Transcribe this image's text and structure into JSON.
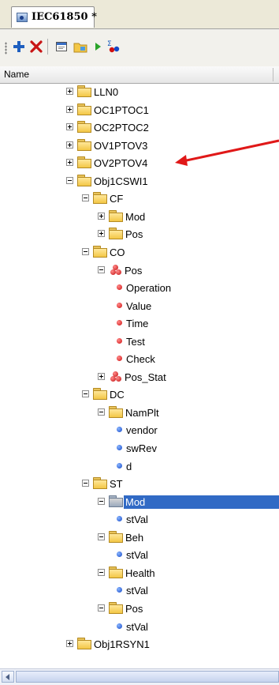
{
  "tab": {
    "title": "IEC61850 *"
  },
  "toolbar": {
    "buttons": [
      {
        "icon": "add-icon"
      },
      {
        "icon": "delete-icon"
      },
      {
        "icon": "window-icon"
      },
      {
        "icon": "folder-icon"
      },
      {
        "icon": "play-icon"
      },
      {
        "icon": "sum-icon"
      }
    ]
  },
  "header": {
    "name": "Name"
  },
  "tree": {
    "nodes": [
      {
        "label": "LLN0",
        "indent": 0,
        "expander": "plus",
        "icon": "folder"
      },
      {
        "label": "OC1PTOC1",
        "indent": 0,
        "expander": "plus",
        "icon": "folder"
      },
      {
        "label": "OC2PTOC2",
        "indent": 0,
        "expander": "plus",
        "icon": "folder"
      },
      {
        "label": "OV1PTOV3",
        "indent": 0,
        "expander": "plus",
        "icon": "folder"
      },
      {
        "label": "OV2PTOV4",
        "indent": 0,
        "expander": "plus",
        "icon": "folder"
      },
      {
        "label": "Obj1CSWI1",
        "indent": 0,
        "expander": "minus",
        "icon": "folder"
      },
      {
        "label": "CF",
        "indent": 1,
        "expander": "minus",
        "icon": "folder"
      },
      {
        "label": "Mod",
        "indent": 2,
        "expander": "plus",
        "icon": "folder"
      },
      {
        "label": "Pos",
        "indent": 2,
        "expander": "plus",
        "icon": "folder"
      },
      {
        "label": "CO",
        "indent": 1,
        "expander": "minus",
        "icon": "folder"
      },
      {
        "label": "Pos",
        "indent": 2,
        "expander": "minus",
        "icon": "cluster"
      },
      {
        "label": "Operation",
        "indent": 3,
        "expander": "none",
        "icon": "dot-red"
      },
      {
        "label": "Value",
        "indent": 3,
        "expander": "none",
        "icon": "dot-red"
      },
      {
        "label": "Time",
        "indent": 3,
        "expander": "none",
        "icon": "dot-red"
      },
      {
        "label": "Test",
        "indent": 3,
        "expander": "none",
        "icon": "dot-red"
      },
      {
        "label": "Check",
        "indent": 3,
        "expander": "none",
        "icon": "dot-red"
      },
      {
        "label": "Pos_Stat",
        "indent": 2,
        "expander": "plus",
        "icon": "cluster"
      },
      {
        "label": "DC",
        "indent": 1,
        "expander": "minus",
        "icon": "folder"
      },
      {
        "label": "NamPlt",
        "indent": 2,
        "expander": "minus",
        "icon": "folder"
      },
      {
        "label": "vendor",
        "indent": 3,
        "expander": "none",
        "icon": "dot-blue"
      },
      {
        "label": "swRev",
        "indent": 3,
        "expander": "none",
        "icon": "dot-blue"
      },
      {
        "label": "d",
        "indent": 3,
        "expander": "none",
        "icon": "dot-blue"
      },
      {
        "label": "ST",
        "indent": 1,
        "expander": "minus",
        "icon": "folder"
      },
      {
        "label": "Mod",
        "indent": 2,
        "expander": "minus",
        "icon": "folder-disabled",
        "selected": true
      },
      {
        "label": "stVal",
        "indent": 3,
        "expander": "none",
        "icon": "dot-blue"
      },
      {
        "label": "Beh",
        "indent": 2,
        "expander": "minus",
        "icon": "folder"
      },
      {
        "label": "stVal",
        "indent": 3,
        "expander": "none",
        "icon": "dot-blue"
      },
      {
        "label": "Health",
        "indent": 2,
        "expander": "minus",
        "icon": "folder"
      },
      {
        "label": "stVal",
        "indent": 3,
        "expander": "none",
        "icon": "dot-blue"
      },
      {
        "label": "Pos",
        "indent": 2,
        "expander": "minus",
        "icon": "folder"
      },
      {
        "label": "stVal",
        "indent": 3,
        "expander": "none",
        "icon": "dot-blue"
      },
      {
        "label": "Obj1RSYN1",
        "indent": 0,
        "expander": "plus",
        "icon": "folder"
      }
    ]
  },
  "colors": {
    "selection": "#316ac5",
    "arrow": "#e01818"
  }
}
